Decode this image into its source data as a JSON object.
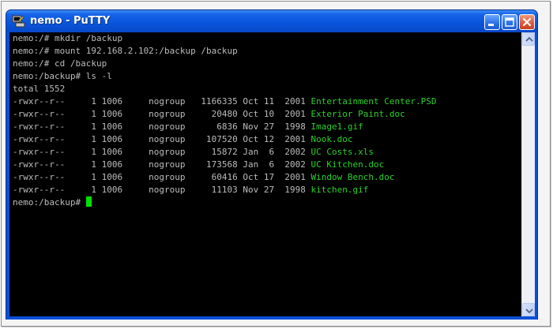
{
  "window": {
    "title": "nemo - PuTTY",
    "icon": "putty-terminal-icon",
    "controls": [
      "minimize-icon",
      "maximize-icon",
      "close-icon"
    ]
  },
  "terminal": {
    "commands": [
      "nemo:/# mkdir /backup",
      "nemo:/# mount 192.168.2.102:/backup /backup",
      "nemo:/# cd /backup",
      "nemo:/backup# ls -l",
      "total 1552"
    ],
    "files": [
      {
        "perms": "-rwxr--r--",
        "links": "1",
        "owner": "1006",
        "group": "nogroup",
        "size": "1166335",
        "date": "Oct 11  2001",
        "name": "Entertainment Center.PSD"
      },
      {
        "perms": "-rwxr--r--",
        "links": "1",
        "owner": "1006",
        "group": "nogroup",
        "size": "20480",
        "date": "Oct 10  2001",
        "name": "Exterior Paint.doc"
      },
      {
        "perms": "-rwxr--r--",
        "links": "1",
        "owner": "1006",
        "group": "nogroup",
        "size": "6836",
        "date": "Nov 27  1998",
        "name": "Image1.gif"
      },
      {
        "perms": "-rwxr--r--",
        "links": "1",
        "owner": "1006",
        "group": "nogroup",
        "size": "107520",
        "date": "Oct 12  2001",
        "name": "Nook.doc"
      },
      {
        "perms": "-rwxr--r--",
        "links": "1",
        "owner": "1006",
        "group": "nogroup",
        "size": "15872",
        "date": "Jan  6  2002",
        "name": "UC Costs.xls"
      },
      {
        "perms": "-rwxr--r--",
        "links": "1",
        "owner": "1006",
        "group": "nogroup",
        "size": "173568",
        "date": "Jan  6  2002",
        "name": "UC Kitchen.doc"
      },
      {
        "perms": "-rwxr--r--",
        "links": "1",
        "owner": "1006",
        "group": "nogroup",
        "size": "60416",
        "date": "Oct 17  2001",
        "name": "Window Bench.doc"
      },
      {
        "perms": "-rwxr--r--",
        "links": "1",
        "owner": "1006",
        "group": "nogroup",
        "size": "11103",
        "date": "Nov 27  1998",
        "name": "kitchen.gif"
      }
    ],
    "prompt": "nemo:/backup# "
  },
  "colors": {
    "titlebar": "#0a55dc",
    "terminal_bg": "#000000",
    "terminal_text": "#bcbcbc",
    "filename_text": "#2cd12c",
    "cursor": "#00e000"
  }
}
